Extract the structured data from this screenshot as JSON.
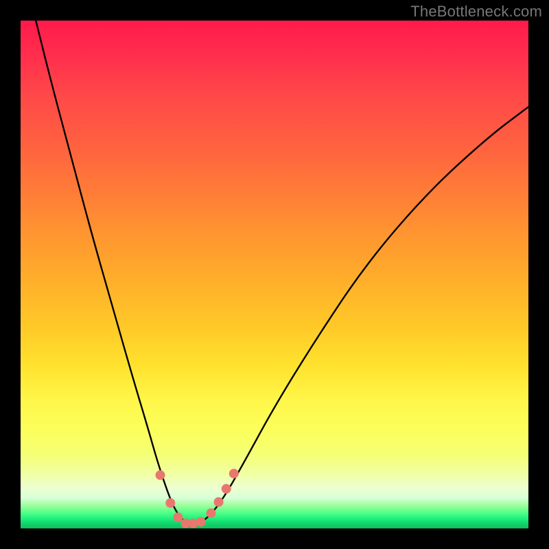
{
  "watermark": "TheBottleneck.com",
  "chart_data": {
    "type": "line",
    "title": "",
    "xlabel": "",
    "ylabel": "",
    "xlim": [
      0,
      100
    ],
    "ylim": [
      0,
      100
    ],
    "series": [
      {
        "name": "bottleneck-curve",
        "x": [
          3,
          6,
          10,
          14,
          18,
          22,
          25,
          27,
          29,
          30.5,
          32,
          33.5,
          35,
          37,
          40,
          44,
          50,
          58,
          68,
          80,
          92,
          100
        ],
        "y": [
          100,
          88,
          73,
          58,
          44,
          30,
          20,
          13,
          7,
          3.5,
          1.5,
          0.8,
          1.0,
          2.2,
          6,
          13,
          24,
          37,
          52,
          66,
          77,
          83
        ]
      }
    ],
    "markers": {
      "name": "highlight-dots",
      "color": "#e8786d",
      "points_xy": [
        [
          27.5,
          10.5
        ],
        [
          29.5,
          5.0
        ],
        [
          31.0,
          2.2
        ],
        [
          32.5,
          1.0
        ],
        [
          34.0,
          1.0
        ],
        [
          35.5,
          1.3
        ],
        [
          37.5,
          3.0
        ],
        [
          39.0,
          5.2
        ],
        [
          40.5,
          7.8
        ],
        [
          42.0,
          10.8
        ]
      ]
    },
    "gradient_stops": [
      {
        "pos": 0.0,
        "color": "#ff1a4b"
      },
      {
        "pos": 0.33,
        "color": "#ff7a38"
      },
      {
        "pos": 0.68,
        "color": "#ffe22e"
      },
      {
        "pos": 0.85,
        "color": "#f5ff76"
      },
      {
        "pos": 0.95,
        "color": "#9bff9b"
      },
      {
        "pos": 1.0,
        "color": "#0fbf60"
      }
    ]
  }
}
